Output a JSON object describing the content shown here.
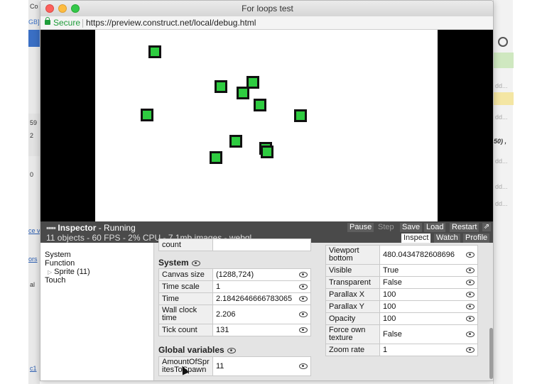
{
  "window": {
    "title": "For loops test",
    "secure_label": "Secure",
    "url": "https://preview.construct.net/local/debug.html",
    "traffic_lights": {
      "close": "#fc605c",
      "minimize": "#fdbc40",
      "maximize": "#34c84a"
    }
  },
  "background_app": {
    "left_fragments": [
      "Co",
      "GB]",
      "59",
      "2",
      "0",
      "ce v",
      "ors",
      "al",
      "c1"
    ],
    "right_fragments": [
      "dd...",
      "dd...",
      "50) ,",
      "dd...",
      "dd...",
      "dd..."
    ],
    "accent_colors": {
      "blue": "#3a6fc4",
      "green": "#cfe8c0",
      "yellow": "#f4e6a3"
    }
  },
  "game": {
    "background": "#000000",
    "canvas_color": "#ffffff",
    "sprite_color": "#2ecc40"
  },
  "inspector": {
    "title": "Inspector",
    "status": "- Running",
    "stats": "11 objects - 60 FPS - 2% CPU - 7.1mb images - webgl",
    "buttons": {
      "pause": "Pause",
      "step": "Step",
      "save": "Save",
      "load": "Load",
      "restart": "Restart"
    },
    "tabs": {
      "inspect": "Inspect",
      "watch": "Watch",
      "profile": "Profile"
    },
    "tree": {
      "system": "System",
      "function": "Function",
      "sprite": "Sprite (11)",
      "touch": "Touch"
    },
    "partial_row_key": "count",
    "system_section": {
      "title": "System",
      "rows": [
        {
          "key": "Canvas size",
          "value": "(1288,724)"
        },
        {
          "key": "Time scale",
          "value": "1"
        },
        {
          "key": "Time",
          "value": "2.1842646666783065"
        },
        {
          "key": "Wall clock time",
          "value": "2.206"
        },
        {
          "key": "Tick count",
          "value": "131"
        }
      ]
    },
    "globals_section": {
      "title": "Global variables",
      "rows": [
        {
          "key": "AmountOfSpritesToSpawn",
          "value": "11"
        }
      ]
    },
    "layer_rows": [
      {
        "key": "Viewport bottom",
        "value": "480.0434782608696"
      },
      {
        "key": "Visible",
        "value": "True"
      },
      {
        "key": "Transparent",
        "value": "False"
      },
      {
        "key": "Parallax X",
        "value": "100"
      },
      {
        "key": "Parallax Y",
        "value": "100"
      },
      {
        "key": "Opacity",
        "value": "100"
      },
      {
        "key": "Force own texture",
        "value": "False"
      },
      {
        "key": "Zoom rate",
        "value": "1"
      }
    ]
  }
}
